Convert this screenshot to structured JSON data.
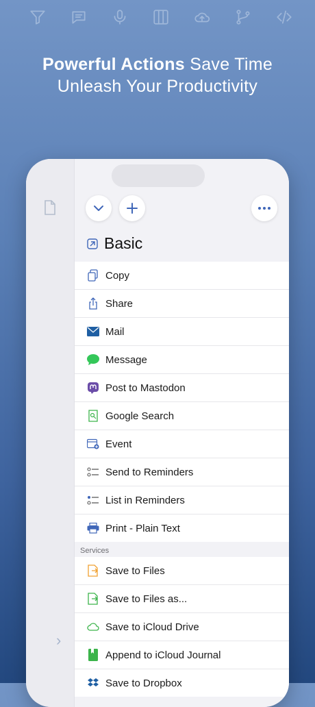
{
  "top_icons": [
    "filter-icon",
    "chat-bubble-icon",
    "microphone-icon",
    "columns-icon",
    "cloud-upload-icon",
    "git-branch-icon",
    "code-icon"
  ],
  "headline": {
    "bold": "Powerful Actions",
    "rest": " Save Time",
    "line2": "Unleash Your Productivity"
  },
  "section_title": "Basic",
  "actions": [
    {
      "label": "Copy",
      "icon": "copy-icon"
    },
    {
      "label": "Share",
      "icon": "share-icon"
    },
    {
      "label": "Mail",
      "icon": "mail-icon"
    },
    {
      "label": "Message",
      "icon": "message-icon"
    },
    {
      "label": "Post to Mastodon",
      "icon": "mastodon-icon"
    },
    {
      "label": "Google Search",
      "icon": "search-doc-icon"
    },
    {
      "label": "Event",
      "icon": "calendar-icon"
    },
    {
      "label": "Send to Reminders",
      "icon": "reminders-icon"
    },
    {
      "label": "List in Reminders",
      "icon": "reminders-list-icon"
    },
    {
      "label": "Print - Plain Text",
      "icon": "printer-icon"
    }
  ],
  "services_header": "Services",
  "services": [
    {
      "label": "Save to Files",
      "icon": "files-icon"
    },
    {
      "label": "Save to Files as...",
      "icon": "files-as-icon"
    },
    {
      "label": "Save to iCloud Drive",
      "icon": "icloud-icon"
    },
    {
      "label": "Append to iCloud Journal",
      "icon": "journal-icon"
    },
    {
      "label": "Save to Dropbox",
      "icon": "dropbox-icon"
    }
  ],
  "colors": {
    "accent": "#3f66b8",
    "mail": "#1f5fa3",
    "message": "#34c759",
    "mastodon": "#6b4da8",
    "files": "#f0a030",
    "green": "#3cb44b"
  }
}
